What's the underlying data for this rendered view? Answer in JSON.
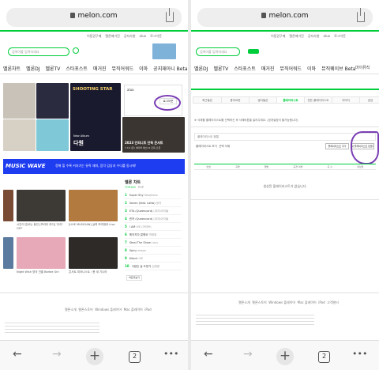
{
  "browser": {
    "url": "melon.com",
    "tab_count": "2",
    "back_icon": "back-arrow-icon",
    "forward_icon": "forward-arrow-icon",
    "new_tab_icon": "plus-icon",
    "more_icon": "more-dots-icon"
  },
  "header": {
    "top_links": [
      "이용권구매",
      "멜론매거진",
      "공지사항",
      "로그아웃"
    ],
    "user": "aluo",
    "logo": "Melon",
    "search_placeholder": "검색어를 입력하세요"
  },
  "nav_left": [
    "멜론차트",
    "멜론DJ",
    "멜론TV",
    "스타포스트",
    "매거진",
    "뮤직어워드",
    "이마",
    "공지재아니 Beta",
    "마이뮤직"
  ],
  "nav_right": [
    "멜론DJ",
    "멜론TV",
    "스타포스트",
    "매거진",
    "뮤직어워드",
    "이마",
    "뮤직웨이브 Beta",
    "마이뮤직"
  ],
  "left": {
    "featured": {
      "title": "SHOOTING STAR",
      "subtitle": "New Album",
      "artist": "다원"
    },
    "concert": {
      "title": "2023 인피니트 단독 콘서트",
      "date": "7.16 (금) 네이버 예스24 단독 오픈"
    },
    "banner": {
      "brand": "MUSIC WAVE",
      "text": "정해 힐 수록 커지기는 뮤직 재미, 음악 감상과 수다를 동시에!"
    },
    "login_label": "aluo",
    "user_link": "로그아웃",
    "chart_title": "멜론 차트",
    "chart_tabs": [
      "TOP100",
      "POP",
      "팝"
    ],
    "chart": [
      {
        "rank": "1",
        "title": "Super Shy",
        "artist": "NewJeans"
      },
      {
        "rank": "2",
        "title": "Seven (feat. Latto)",
        "artist": "정국"
      },
      {
        "rank": "3",
        "title": "ETA (Queencard)",
        "artist": "(여자)아이들"
      },
      {
        "rank": "4",
        "title": "퀸카 (Queencard)",
        "artist": "(여자)아이들"
      },
      {
        "rank": "5",
        "title": "I AM",
        "artist": "IVE (아이브)"
      },
      {
        "rank": "6",
        "title": "헤어지자 말해요",
        "artist": "박재정"
      },
      {
        "rank": "7",
        "title": "Steal The Show",
        "artist": "Lauv"
      },
      {
        "rank": "8",
        "title": "Spicy",
        "artist": "aespa"
      },
      {
        "rank": "9",
        "title": "Kitsch",
        "artist": "IVE"
      },
      {
        "rank": "10",
        "title": "사랑은 늘 도망가",
        "artist": "임영웅"
      }
    ],
    "more_chart": "차트더보기",
    "videos": [
      {
        "title": "시간이 흐르는 동안 [프리티 리더] '우리' OST",
        "by": "DEAN"
      },
      {
        "title": "[LIVE MUSICIAN] 실력 보여줘라 Live",
        "by": "이무진"
      },
      {
        "title": "Loss (Official Live)",
        "by": "Dean"
      },
      {
        "title": "Night Wish 영국 진출 Barbie Girl",
        "by": "Aqua"
      },
      {
        "title": "콘서트 피아니스트 : 봄 새 기나라",
        "by": "조성진"
      },
      {
        "title": "공연",
        "by": "아카이브"
      }
    ],
    "footer_links": [
      "멜론소개",
      "멜론스토어",
      "Windows 플레이어",
      "Mac 플레이어",
      "iPad",
      "고객센터"
    ]
  },
  "right": {
    "tabs": [
      "마이뮤직",
      "최근들은",
      "좋아요한",
      "많이들은",
      "플레이리스트",
      "만든 플레이리스트",
      "이미지",
      "공감"
    ],
    "active_tab": "플레이리스트",
    "notice": "※ 삭제할 플레이리스트를 선택하신 후 삭제버튼을 눌러주세요. (공개설정이 불가능합니다)",
    "sort_label": "플레이리스트 정렬",
    "buttons": [
      "플레이리스트 보기",
      "플레이리스트 추가",
      "선택 삭제"
    ],
    "playlist_btn_highlight": "새 플레이리스트 만들기",
    "list_header": [
      "번호",
      "곡명",
      "앨범",
      "공개 여부",
      "곡 수",
      "생성일"
    ],
    "empty_text": "생성된 플레이리스트가 없습니다.",
    "footer_links": [
      "멜론소개",
      "멜론스토어",
      "Windows 플레이어",
      "Mac 플레이어",
      "iPad",
      "고객센터"
    ]
  },
  "colors": {
    "brand": "#00cd3c",
    "annotation": "#7b3fb5",
    "banner": "#1e3cf0"
  }
}
